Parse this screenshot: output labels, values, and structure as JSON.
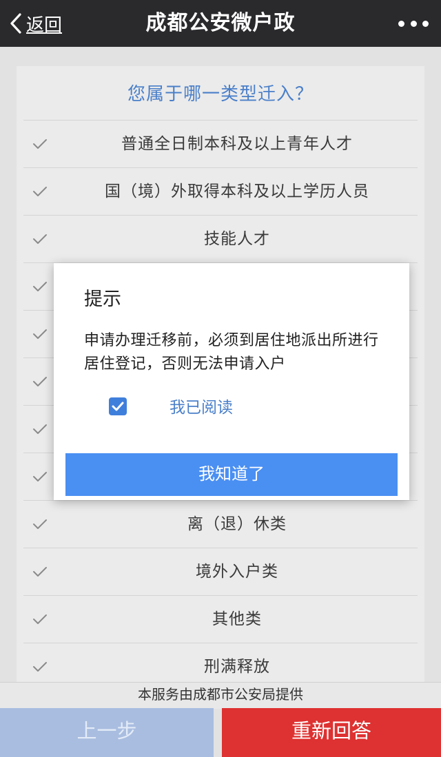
{
  "header": {
    "back_label": "返回",
    "title": "成都公安微户政",
    "more_icon": "more-dots-icon"
  },
  "question": "您属于哪一类型迁入？",
  "options": [
    {
      "label": "普通全日制本科及以上青年人才"
    },
    {
      "label": "国（境）外取得本科及以上学历人员"
    },
    {
      "label": "技能人才"
    },
    {
      "label": ""
    },
    {
      "label": ""
    },
    {
      "label": ""
    },
    {
      "label": ""
    },
    {
      "label": ""
    },
    {
      "label": "离（退）休类"
    },
    {
      "label": "境外入户类"
    },
    {
      "label": "其他类"
    },
    {
      "label": "刑满释放"
    }
  ],
  "dialog": {
    "title": "提示",
    "message": "申请办理迁移前，必须到居住地派出所进行居住登记，否则无法申请入户",
    "checkbox_label": "我已阅读",
    "checkbox_checked": true,
    "confirm_label": "我知道了"
  },
  "footer": {
    "note": "本服务由成都市公安局提供",
    "prev_label": "上一步",
    "restart_label": "重新回答"
  },
  "colors": {
    "navbar": "#2a2a2d",
    "accent_blue": "#4a7fc9",
    "confirm_button": "#4a8ff2",
    "restart_button": "#de3131",
    "prev_button_disabled": "#a9bde0"
  }
}
